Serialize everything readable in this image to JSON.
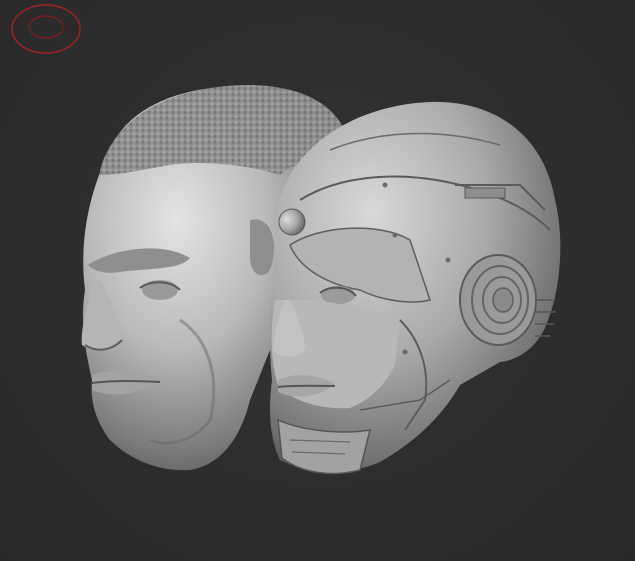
{
  "viewport": {
    "background": "#2e2e2e",
    "navigation_gizmo": {
      "icon": "navigation-gizmo-icon",
      "color": "#a32020"
    },
    "models": [
      {
        "name": "human-head-sculpt",
        "material": "gray-clay"
      },
      {
        "name": "cyborg-head-sculpt",
        "material": "gray-clay"
      }
    ]
  }
}
